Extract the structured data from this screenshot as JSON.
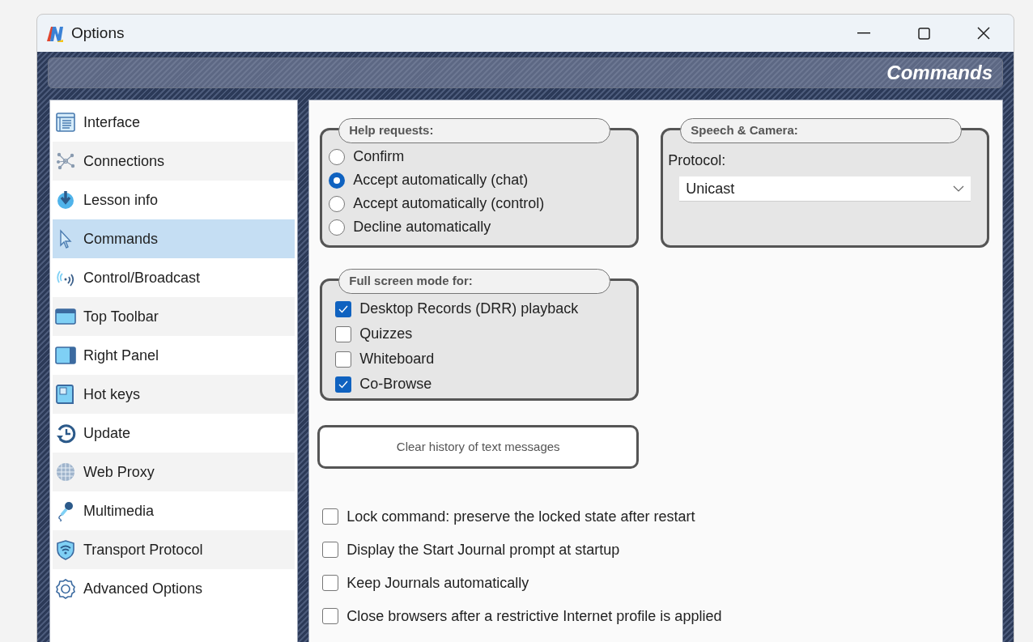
{
  "window": {
    "title": "Options"
  },
  "header": {
    "title": "Commands"
  },
  "sidebar": {
    "items": [
      {
        "label": "Interface",
        "selected": false
      },
      {
        "label": "Connections",
        "selected": false
      },
      {
        "label": "Lesson info",
        "selected": false
      },
      {
        "label": "Commands",
        "selected": true
      },
      {
        "label": "Control/Broadcast",
        "selected": false
      },
      {
        "label": "Top Toolbar",
        "selected": false
      },
      {
        "label": "Right Panel",
        "selected": false
      },
      {
        "label": "Hot keys",
        "selected": false
      },
      {
        "label": "Update",
        "selected": false
      },
      {
        "label": "Web Proxy",
        "selected": false
      },
      {
        "label": "Multimedia",
        "selected": false
      },
      {
        "label": "Transport Protocol",
        "selected": false
      },
      {
        "label": "Advanced Options",
        "selected": false
      }
    ]
  },
  "help_requests": {
    "title": "Help requests:",
    "options": [
      {
        "label": "Confirm",
        "selected": false
      },
      {
        "label": "Accept automatically (chat)",
        "selected": true
      },
      {
        "label": "Accept automatically (control)",
        "selected": false
      },
      {
        "label": "Decline automatically",
        "selected": false
      }
    ]
  },
  "speech_camera": {
    "title": "Speech & Camera:",
    "protocol_label": "Protocol:",
    "protocol_value": "Unicast"
  },
  "full_screen": {
    "title": "Full screen mode for:",
    "items": [
      {
        "label": "Desktop Records (DRR) playback",
        "checked": true
      },
      {
        "label": "Quizzes",
        "checked": false
      },
      {
        "label": "Whiteboard",
        "checked": false
      },
      {
        "label": "Co-Browse",
        "checked": true
      }
    ]
  },
  "clear_button": "Clear history of text messages",
  "options": [
    {
      "label": "Lock command: preserve the locked state after restart",
      "checked": false
    },
    {
      "label": "Display the Start Journal prompt at startup",
      "checked": false
    },
    {
      "label": "Keep Journals automatically",
      "checked": false
    },
    {
      "label": "Close browsers after a restrictive Internet profile is applied",
      "checked": false
    }
  ]
}
